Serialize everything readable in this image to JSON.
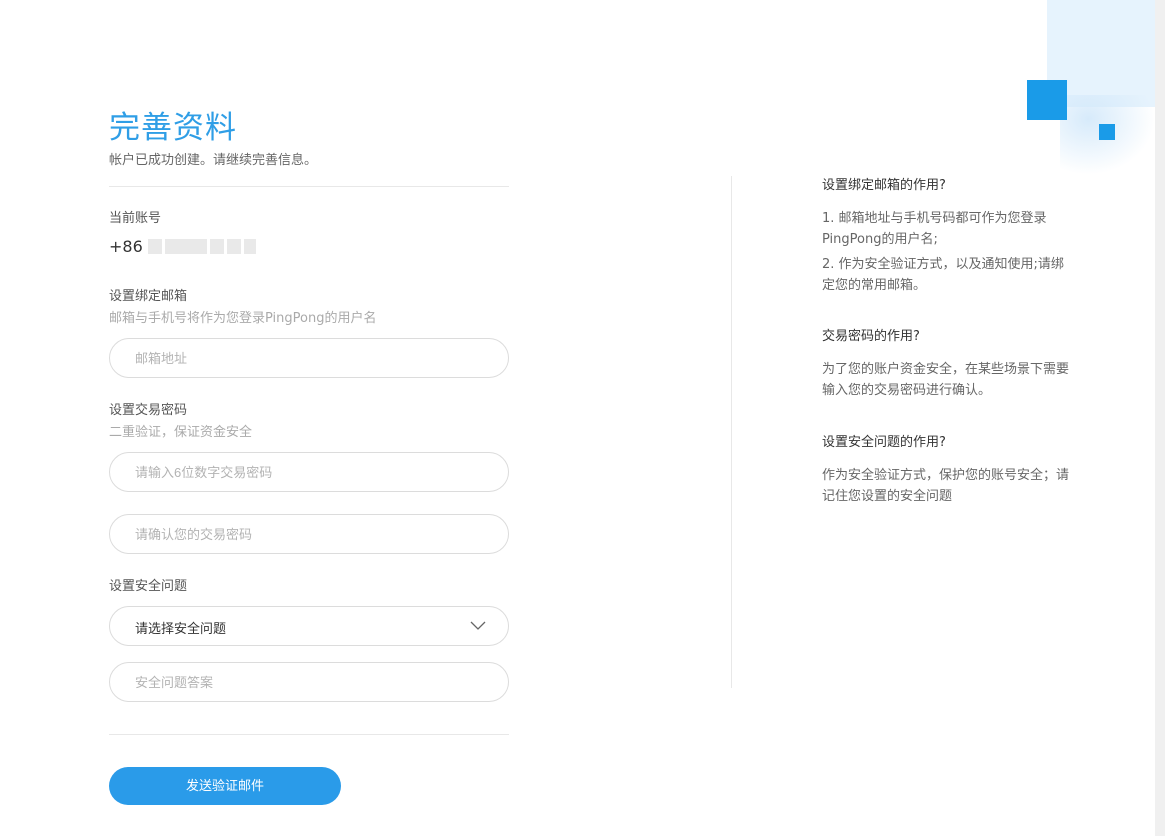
{
  "header": {
    "title": "完善资料",
    "subtitle": "帐户已成功创建。请继续完善信息。"
  },
  "account": {
    "label": "当前账号",
    "value": "+86"
  },
  "email": {
    "label": "设置绑定邮箱",
    "hint": "邮箱与手机号将作为您登录PingPong的用户名",
    "placeholder": "邮箱地址"
  },
  "trade_password": {
    "label": "设置交易密码",
    "hint": "二重验证，保证资金安全",
    "placeholder": "请输入6位数字交易密码",
    "confirm_placeholder": "请确认您的交易密码"
  },
  "security_question": {
    "label": "设置安全问题",
    "selected": "请选择安全问题",
    "answer_placeholder": "安全问题答案"
  },
  "submit": {
    "label": "发送验证邮件"
  },
  "faq": [
    {
      "question": "设置绑定邮箱的作用?",
      "answers": [
        "1. 邮箱地址与手机号码都可作为您登录PingPong的用户名;",
        "2. 作为安全验证方式，以及通知使用;请绑定您的常用邮箱。"
      ]
    },
    {
      "question": "交易密码的作用?",
      "answers": [
        "为了您的账户资金安全，在某些场景下需要输入您的交易密码进行确认。"
      ]
    },
    {
      "question": "设置安全问题的作用?",
      "answers": [
        "作为安全验证方式，保护您的账号安全；请记住您设置的安全问题"
      ]
    }
  ],
  "colors": {
    "accent": "#2a9be9",
    "title": "#2f9ee6"
  }
}
